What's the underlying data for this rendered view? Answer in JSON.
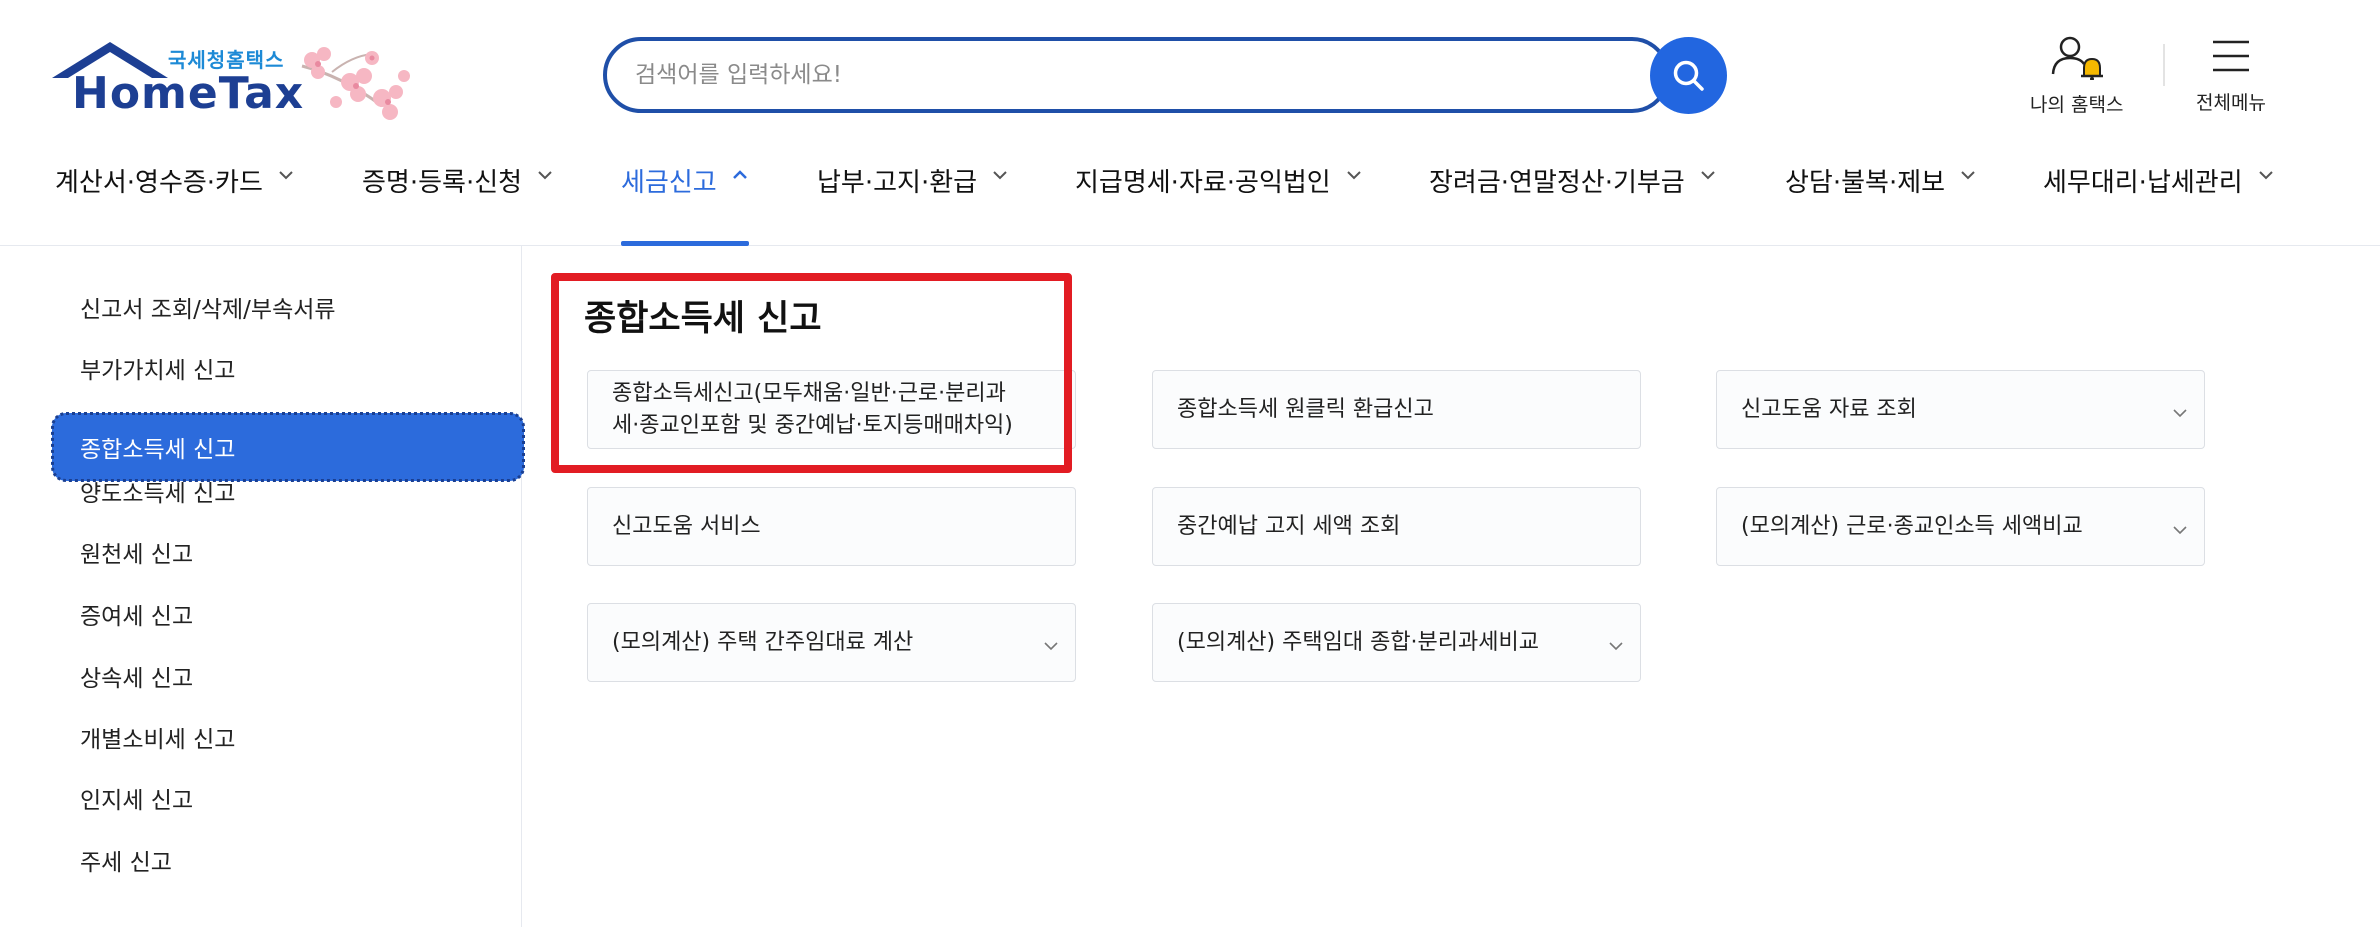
{
  "logo": {
    "korean": "국세청홈택스",
    "english": "HomeTax"
  },
  "search": {
    "placeholder": "검색어를 입력하세요!"
  },
  "util": {
    "my_hometax": "나의 홈택스",
    "all_menu": "전체메뉴"
  },
  "gnb": [
    {
      "label": "계산서·영수증·카드",
      "active": false
    },
    {
      "label": "증명·등록·신청",
      "active": false
    },
    {
      "label": "세금신고",
      "active": true
    },
    {
      "label": "납부·고지·환급",
      "active": false
    },
    {
      "label": "지급명세·자료·공익법인",
      "active": false
    },
    {
      "label": "장려금·연말정산·기부금",
      "active": false
    },
    {
      "label": "상담·불복·제보",
      "active": false
    },
    {
      "label": "세무대리·납세관리",
      "active": false
    }
  ],
  "sidebar": {
    "items": [
      {
        "label": "신고서 조회/삭제/부속서류"
      },
      {
        "label": "부가가치세 신고"
      },
      {
        "label": "종합소득세 신고",
        "active": true
      },
      {
        "label": "양도소득세 신고"
      },
      {
        "label": "원천세 신고"
      },
      {
        "label": "증여세 신고"
      },
      {
        "label": "상속세 신고"
      },
      {
        "label": "개별소비세 신고"
      },
      {
        "label": "인지세 신고"
      },
      {
        "label": "주세 신고"
      }
    ]
  },
  "content": {
    "title": "종합소득세 신고",
    "cards": [
      {
        "line1": "종합소득세신고(모두채움·일반·근로·분리과",
        "line2": "세·종교인포함 및 중간예납·토지등매매차익)",
        "has_dropdown": false
      },
      {
        "line1": "종합소득세 원클릭 환급신고",
        "has_dropdown": false
      },
      {
        "line1": "신고도움 자료 조회",
        "has_dropdown": true
      },
      {
        "line1": "신고도움 서비스",
        "has_dropdown": false
      },
      {
        "line1": "중간예납 고지 세액 조회",
        "has_dropdown": false
      },
      {
        "line1": "(모의계산) 근로·종교인소득 세액비교",
        "has_dropdown": true
      },
      {
        "line1": "(모의계산) 주택 간주임대료 계산",
        "has_dropdown": true
      },
      {
        "line1": "(모의계산) 주택임대 종합·분리과세비교",
        "has_dropdown": true
      }
    ]
  },
  "colors": {
    "primary": "#2c6bdc",
    "logo_navy": "#1d3f93",
    "highlight": "#e21c23",
    "search_border": "#1f4fa8"
  }
}
